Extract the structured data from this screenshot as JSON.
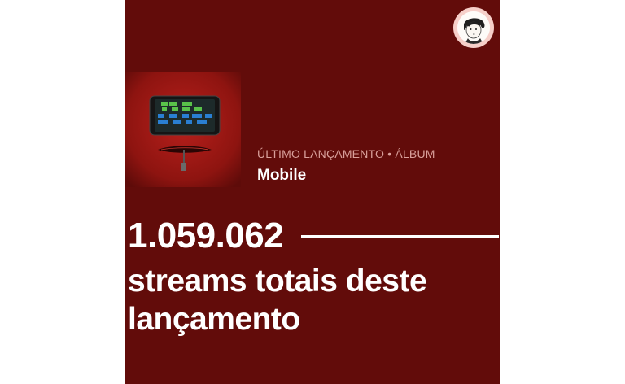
{
  "release": {
    "kicker": "ÚLTIMO LANÇAMENTO • ÁLBUM",
    "title": "Mobile"
  },
  "stats": {
    "stream_count": "1.059.062",
    "caption": "streams totais deste lançamento"
  },
  "icons": {
    "avatar": "profile-avatar-icon",
    "cover": "phone-on-red-album-cover"
  },
  "colors": {
    "background": "#620c0a",
    "kicker": "#d9a09b",
    "text": "#ffffff",
    "avatar_ring": "#f6cfc9"
  }
}
